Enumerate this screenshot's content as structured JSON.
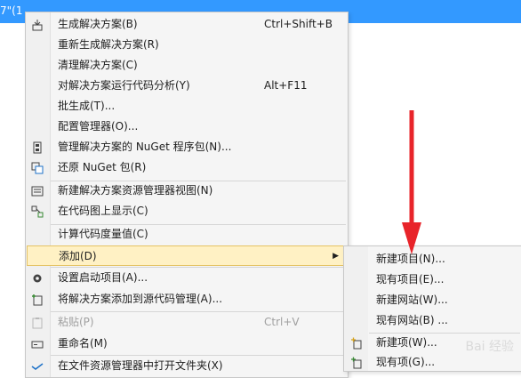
{
  "titlebar": {
    "text": "7\"(1 ..."
  },
  "menu": {
    "items": [
      {
        "label": "生成解决方案(B)",
        "shortcut": "Ctrl+Shift+B",
        "icon": "build-icon"
      },
      {
        "label": "重新生成解决方案(R)",
        "shortcut": "",
        "icon": ""
      },
      {
        "label": "清理解决方案(C)",
        "shortcut": "",
        "icon": ""
      },
      {
        "label": "对解决方案运行代码分析(Y)",
        "shortcut": "Alt+F11",
        "icon": ""
      },
      {
        "label": "批生成(T)...",
        "shortcut": "",
        "icon": ""
      },
      {
        "label": "配置管理器(O)...",
        "shortcut": "",
        "icon": ""
      },
      {
        "label": "管理解决方案的 NuGet 程序包(N)...",
        "shortcut": "",
        "icon": "nuget-icon"
      },
      {
        "label": "还原 NuGet 包(R)",
        "shortcut": "",
        "icon": "restore-package-icon"
      },
      {
        "label": "新建解决方案资源管理器视图(N)",
        "shortcut": "",
        "icon": "new-view-icon"
      },
      {
        "label": "在代码图上显示(C)",
        "shortcut": "",
        "icon": "code-map-icon"
      },
      {
        "label": "计算代码度量值(C)",
        "shortcut": "",
        "icon": ""
      },
      {
        "label": "添加(D)",
        "shortcut": "",
        "icon": ""
      },
      {
        "label": "设置启动项目(A)...",
        "shortcut": "",
        "icon": "gear-icon"
      },
      {
        "label": "将解决方案添加到源代码管理(A)...",
        "shortcut": "",
        "icon": "source-control-add-icon"
      },
      {
        "label": "粘贴(P)",
        "shortcut": "Ctrl+V",
        "icon": "paste-icon"
      },
      {
        "label": "重命名(M)",
        "shortcut": "",
        "icon": "rename-icon"
      },
      {
        "label": "在文件资源管理器中打开文件夹(X)",
        "shortcut": "",
        "icon": "open-folder-icon"
      }
    ]
  },
  "submenu": {
    "items": [
      {
        "label": "新建项目(N)...",
        "icon": ""
      },
      {
        "label": "现有项目(E)...",
        "icon": ""
      },
      {
        "label": "新建网站(W)...",
        "icon": ""
      },
      {
        "label": "现有网站(B) ...",
        "icon": ""
      },
      {
        "label": "新建项(W)...",
        "icon": "new-item-icon"
      },
      {
        "label": "现有项(G)...",
        "icon": "existing-item-icon"
      }
    ]
  },
  "annotation": {
    "color": "#e8242a"
  },
  "watermark": {
    "text": "Bai 经验"
  },
  "colors": {
    "accent": "#3399ff",
    "highlight": "#fff1c4",
    "highlight_border": "#e5c365"
  }
}
